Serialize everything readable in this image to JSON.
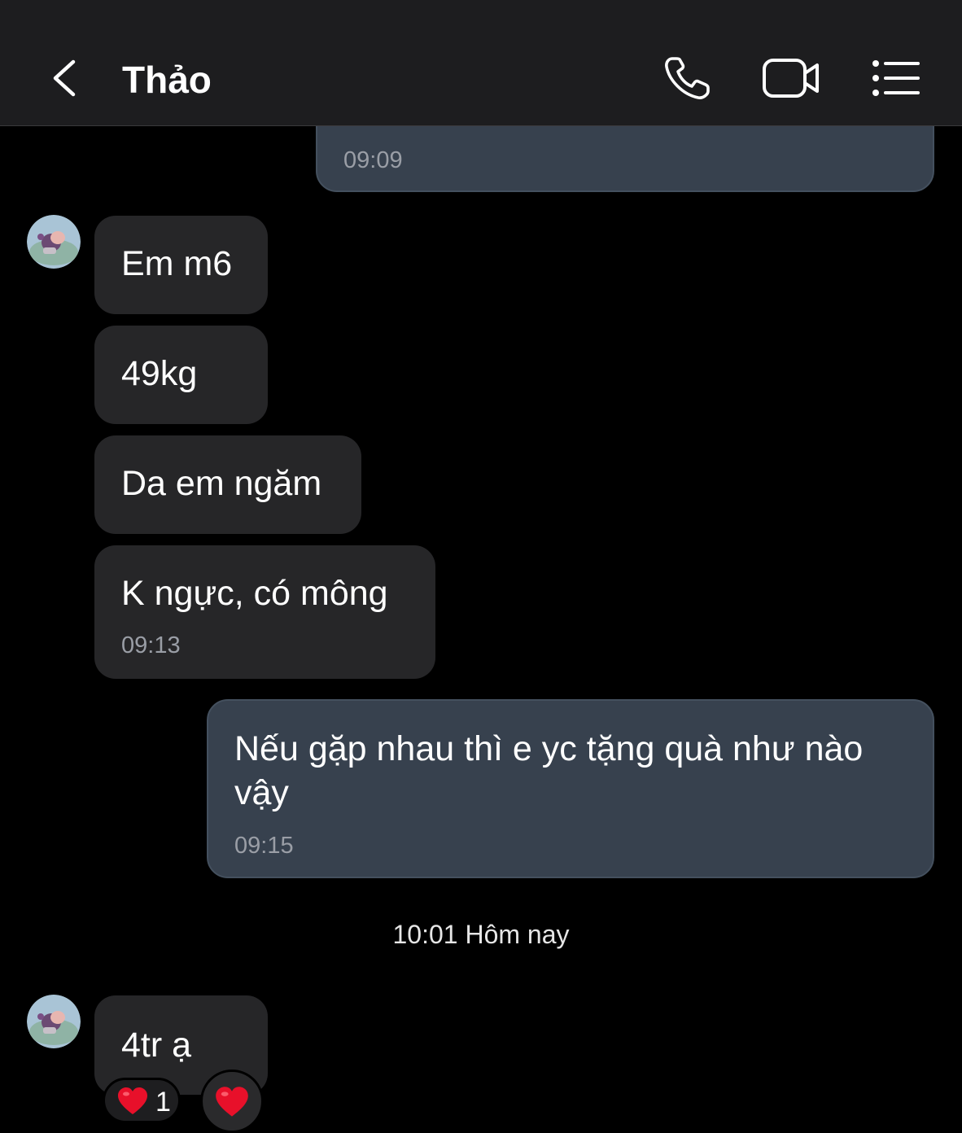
{
  "header": {
    "title": "Thảo",
    "back_icon": "chevron-left-icon",
    "call_icon": "phone-icon",
    "video_icon": "video-camera-icon",
    "menu_icon": "list-menu-icon"
  },
  "messages": [
    {
      "direction": "outgoing",
      "time": "09:09"
    },
    {
      "direction": "incoming",
      "text": "Em m6"
    },
    {
      "direction": "incoming",
      "text": "49kg"
    },
    {
      "direction": "incoming",
      "text": "Da em ngăm"
    },
    {
      "direction": "incoming",
      "text": "K ngực, có mông",
      "time": "09:13"
    },
    {
      "direction": "outgoing",
      "text_line1": "Nếu gặp nhau thì e yc tặng quà như nào",
      "text_line2": "vậy",
      "time": "09:15"
    },
    {
      "direction": "incoming",
      "text": "4tr ạ",
      "reaction": {
        "icon": "heart-icon",
        "count": "1"
      }
    }
  ],
  "date_separator": "10:01 Hôm nay",
  "reaction_picker": {
    "icon": "heart-icon"
  },
  "colors": {
    "header_bg": "#1d1d1f",
    "incoming_bubble": "#262628",
    "outgoing_bubble": "#37414e",
    "heart": "#e8102a"
  }
}
